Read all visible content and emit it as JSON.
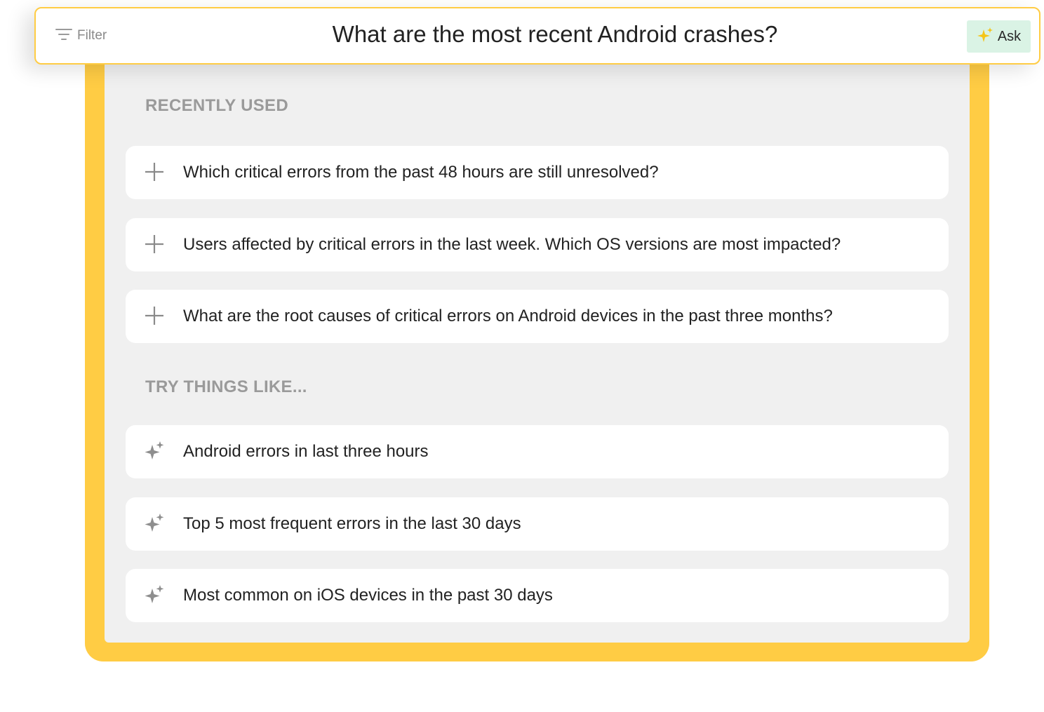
{
  "search": {
    "filter_label": "Filter",
    "filter_icon": "filter-icon",
    "query": "What are the most recent Android crashes?",
    "ask_label": "Ask",
    "ask_icon": "sparkle-icon"
  },
  "recently_used": {
    "heading": "RECENTLY USED",
    "icon": "plus-icon",
    "items": [
      {
        "label": "Which critical errors from the past 48 hours are still unresolved?"
      },
      {
        "label": "Users affected by critical errors in the last week. Which OS versions are most impacted?"
      },
      {
        "label": "What are the root causes of critical errors on Android devices in the past three months?"
      }
    ]
  },
  "suggestions": {
    "heading": "TRY THINGS LIKE...",
    "icon": "sparkle-icon",
    "items": [
      {
        "label": "Android errors in last three hours"
      },
      {
        "label": "Top 5 most frequent errors in the last 30 days"
      },
      {
        "label": "Most common on iOS devices in the past 30 days"
      }
    ]
  },
  "colors": {
    "frame": "#FFCC44",
    "panel": "#F0F0F0",
    "ask_bg": "#DAF3E5",
    "sparkle_accent": "#F5C518"
  }
}
